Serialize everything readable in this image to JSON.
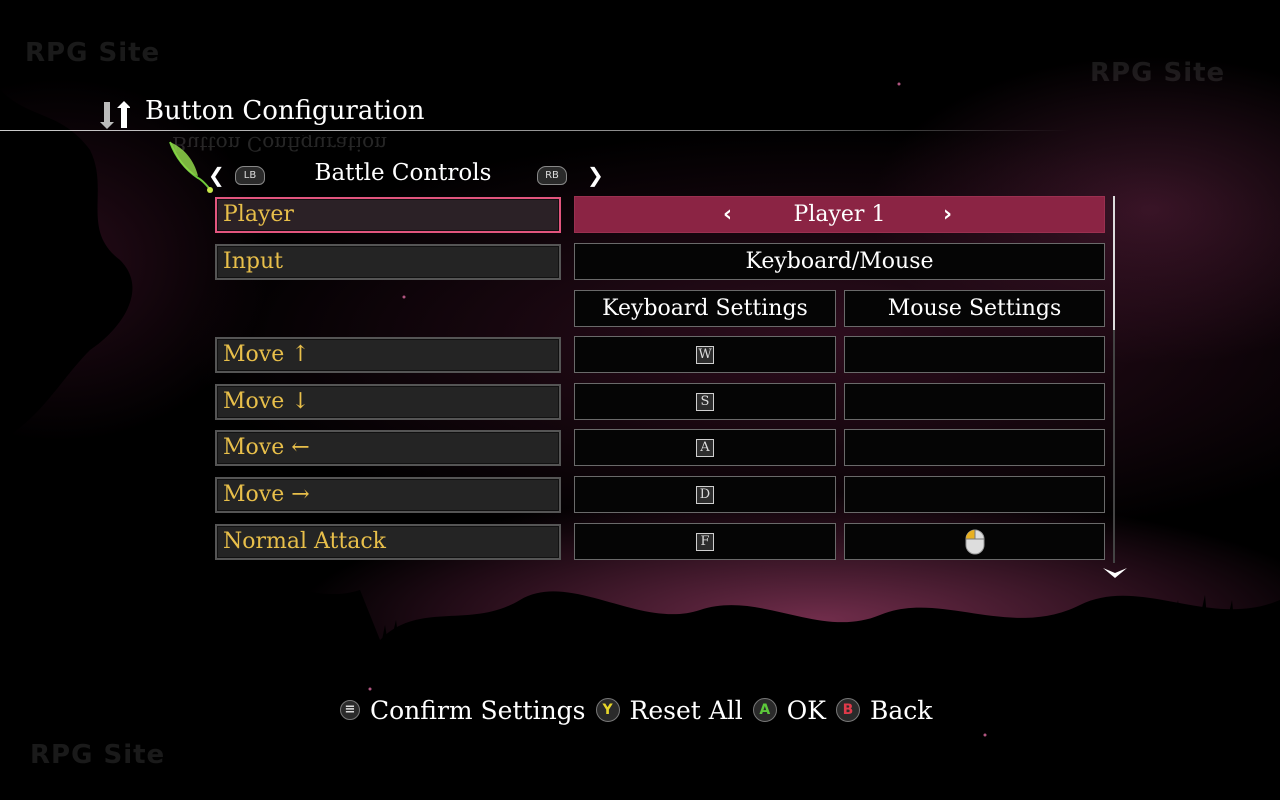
{
  "watermarks": [
    "RPG Site",
    "RPG Site",
    "RPG Site"
  ],
  "header": {
    "title": "Button Configuration",
    "icon": "up-down-arrows-icon"
  },
  "tabs": {
    "left_bumper": "LB",
    "right_bumper": "RB",
    "current": "Battle Controls"
  },
  "rows": {
    "player": {
      "label": "Player",
      "value": "Player 1"
    },
    "input": {
      "label": "Input",
      "value": "Keyboard/Mouse"
    },
    "headers": {
      "keyboard": "Keyboard Settings",
      "mouse": "Mouse Settings"
    },
    "bindings": [
      {
        "label": "Move ↑",
        "key": "W",
        "mouse": ""
      },
      {
        "label": "Move ↓",
        "key": "S",
        "mouse": ""
      },
      {
        "label": "Move ←",
        "key": "A",
        "mouse": ""
      },
      {
        "label": "Move →",
        "key": "D",
        "mouse": ""
      },
      {
        "label": "Normal Attack",
        "key": "F",
        "mouse": "left-mouse-button-icon"
      }
    ]
  },
  "footer": {
    "confirm": {
      "glyph": "≡",
      "label": "Confirm Settings"
    },
    "reset": {
      "glyph": "Y",
      "label": "Reset All"
    },
    "ok": {
      "glyph": "A",
      "label": "OK"
    },
    "back": {
      "glyph": "B",
      "label": "Back"
    }
  },
  "colors": {
    "accent": "#8b2444",
    "label_text": "#e8bf4a",
    "selection_border": "#e2557e",
    "button_y": "#e6d52a",
    "button_a": "#5cc83a",
    "button_b": "#e03a4a"
  }
}
